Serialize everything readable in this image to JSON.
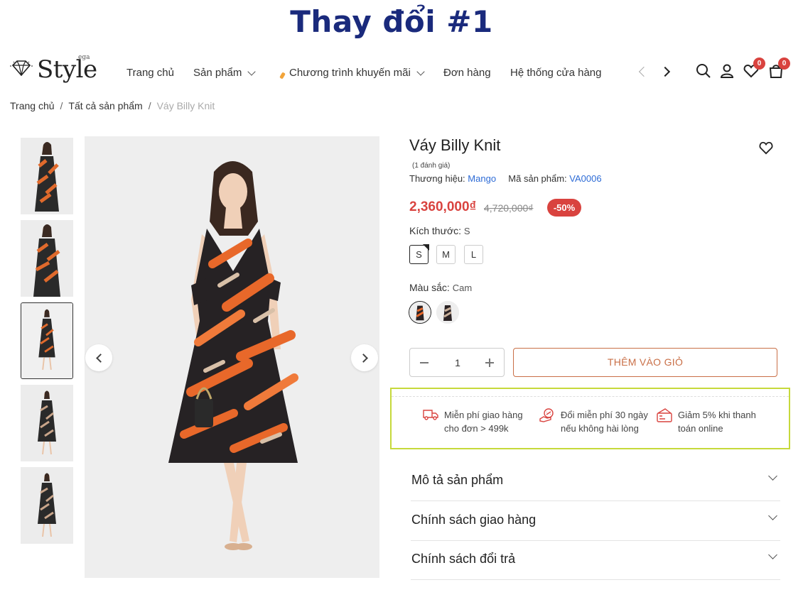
{
  "banner": {
    "title": "Thay đổi #1"
  },
  "header": {
    "logo": {
      "word": "Style",
      "small": "ega"
    },
    "nav": [
      {
        "label": "Trang chủ",
        "has_dropdown": false
      },
      {
        "label": "Sản phẩm",
        "has_dropdown": true
      },
      {
        "label": "Chương trình khuyến mãi",
        "has_dropdown": true
      },
      {
        "label": "Đơn hàng",
        "has_dropdown": false
      },
      {
        "label": "Hệ thống cửa hàng",
        "has_dropdown": false
      }
    ],
    "icons": [
      "search-icon",
      "user-icon",
      "heart-icon",
      "cart-icon"
    ],
    "wishlist_count": "0",
    "cart_count": "0"
  },
  "breadcrumb": {
    "items": [
      "Trang chủ",
      "Tất cả sản phẩm",
      "Váy Billy Knit"
    ],
    "separator": "/"
  },
  "product": {
    "title": "Váy Billy Knit",
    "rating_text": "(1 đánh giá)",
    "brand_label": "Thương hiệu:",
    "brand": "Mango",
    "sku_label": "Mã sản phẩm:",
    "sku": "VA0006",
    "price": "2,360,000₫",
    "old_price": "4,720,000₫",
    "discount": "-50%",
    "size_label": "Kích thước:",
    "size_selected": "S",
    "sizes": [
      "S",
      "M",
      "L"
    ],
    "color_label": "Màu sắc:",
    "color_selected": "Cam",
    "quantity": "1",
    "add_to_cart": "THÊM VÀO GIỎ"
  },
  "perks": [
    {
      "icon": "truck-icon",
      "line1": "Miễn phí giao hàng",
      "line2": "cho đơn > 499k"
    },
    {
      "icon": "exchange-icon",
      "line1": "Đổi miễn phí 30 ngày",
      "line2": "nếu không hài lòng"
    },
    {
      "icon": "card-icon",
      "line1": "Giảm 5% khi thanh",
      "line2": "toán online"
    }
  ],
  "accordions": [
    "Mô tả sản phẩm",
    "Chính sách giao hàng",
    "Chính sách đổi trả"
  ],
  "colors": {
    "accent_red": "#d9433f",
    "accent_brown": "#c96f47",
    "link_blue": "#2d6bd6",
    "banner_blue": "#1a2a7c",
    "promo_border": "#c6d93b"
  }
}
